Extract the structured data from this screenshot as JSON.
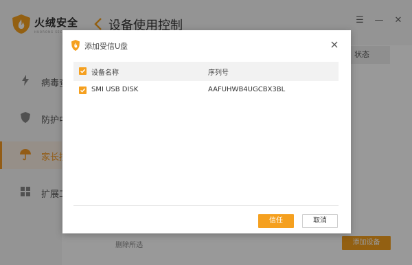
{
  "app": {
    "brand": "火绒安全",
    "brand_sub": "HUORONG SECURITY",
    "page_title": "设备使用控制",
    "window_controls": [
      "menu-icon",
      "minimize-icon",
      "close-icon"
    ]
  },
  "sidebar": {
    "items": [
      {
        "label": "病毒查杀",
        "icon": "bolt-icon",
        "active": false
      },
      {
        "label": "防护中心",
        "icon": "shield-icon",
        "active": false
      },
      {
        "label": "家长控制",
        "icon": "umbrella-icon",
        "active": true
      },
      {
        "label": "扩展工具",
        "icon": "grid-icon",
        "active": false
      }
    ]
  },
  "main": {
    "status_header": "状态",
    "remove_selected": "删除所选",
    "add_device": "添加设备"
  },
  "dialog": {
    "title": "添加受信U盘",
    "columns": {
      "name": "设备名称",
      "serial": "序列号"
    },
    "rows": [
      {
        "name": "SMI USB DISK",
        "serial": "AAFUHWB4UGCBX3BL",
        "checked": true
      }
    ],
    "header_checked": true,
    "trust_button": "信任",
    "cancel_button": "取消"
  },
  "colors": {
    "accent": "#f5a01f",
    "active_bg": "#fbefe3",
    "sidebar_bg": "#f7f7f7"
  }
}
